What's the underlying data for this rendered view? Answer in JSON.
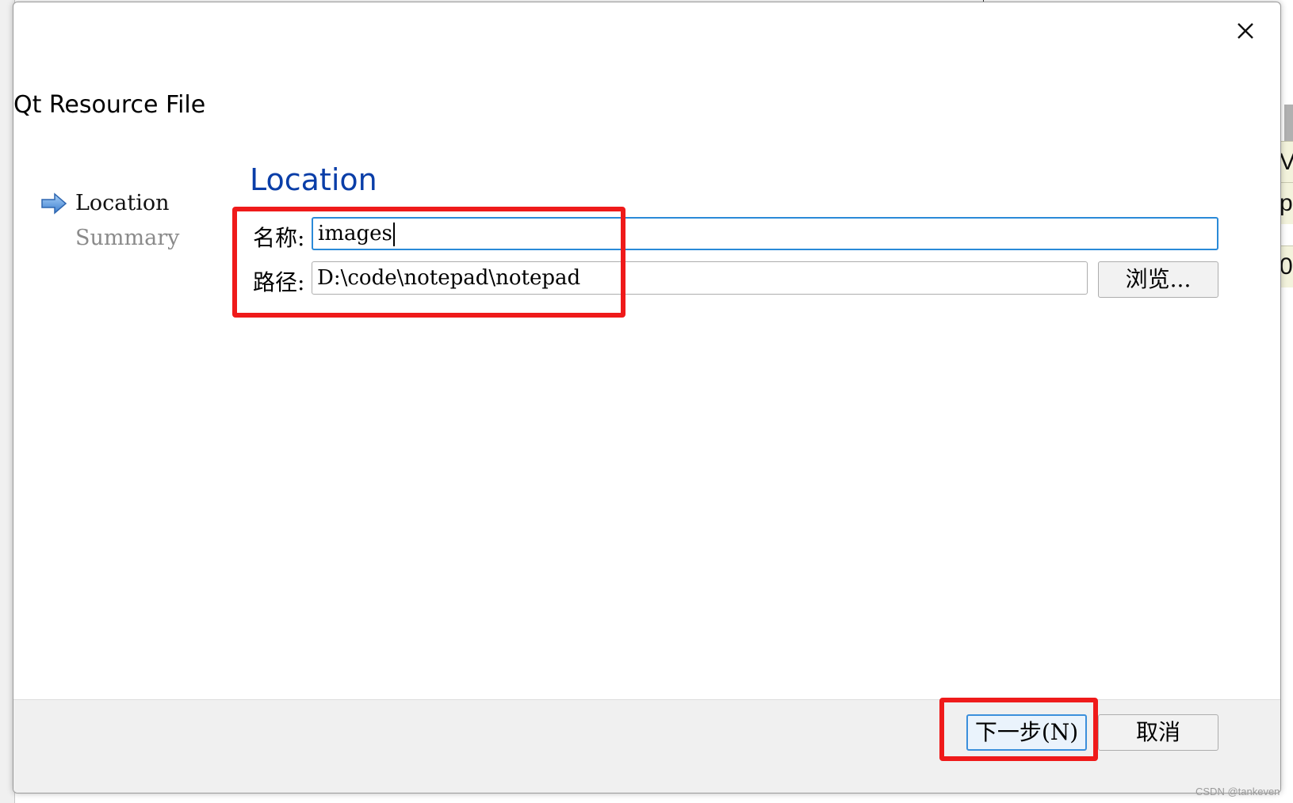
{
  "wizard": {
    "title": "Qt Resource File",
    "steps": [
      {
        "label": "Location",
        "state": "active"
      },
      {
        "label": "Summary",
        "state": "inactive"
      }
    ]
  },
  "page": {
    "heading": "Location",
    "name_label": "名称:",
    "name_value": "images",
    "path_label": "路径:",
    "path_value": "D:\\code\\notepad\\notepad",
    "browse_label": "浏览..."
  },
  "footer": {
    "next_label": "下一步(N)",
    "cancel_label": "取消"
  },
  "background": {
    "right_rows": [
      "V",
      "p",
      "0"
    ]
  },
  "watermark": "CSDN @tankeven",
  "colors": {
    "heading": "#0a3ea8",
    "highlight": "#ef1a1a",
    "focus": "#2a8ad8"
  },
  "icons": {
    "close": "close-icon",
    "current_step": "arrow-right-icon"
  }
}
